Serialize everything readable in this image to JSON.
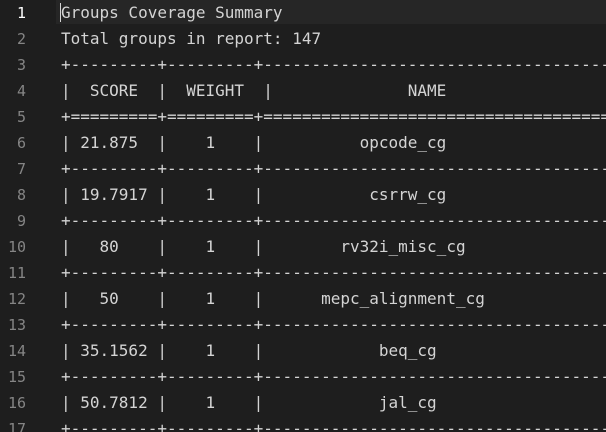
{
  "editor": {
    "lines": [
      {
        "number": "1",
        "text": "Groups Coverage Summary"
      },
      {
        "number": "2",
        "text": "Total groups in report: 147"
      },
      {
        "number": "3",
        "text": "+---------+---------+-------------------------------------------"
      },
      {
        "number": "4",
        "text": "|  SCORE  |  WEIGHT  |              NAME"
      },
      {
        "number": "5",
        "text": "+=========+=========+==========================================="
      },
      {
        "number": "6",
        "text": "| 21.875  |    1    |          opcode_cg"
      },
      {
        "number": "7",
        "text": "+---------+---------+-------------------------------------------"
      },
      {
        "number": "8",
        "text": "| 19.7917 |    1    |           csrrw_cg"
      },
      {
        "number": "9",
        "text": "+---------+---------+-------------------------------------------"
      },
      {
        "number": "10",
        "text": "|   80    |    1    |        rv32i_misc_cg"
      },
      {
        "number": "11",
        "text": "+---------+---------+-------------------------------------------"
      },
      {
        "number": "12",
        "text": "|   50    |    1    |      mepc_alignment_cg"
      },
      {
        "number": "13",
        "text": "+---------+---------+-------------------------------------------"
      },
      {
        "number": "14",
        "text": "| 35.1562 |    1    |            beq_cg"
      },
      {
        "number": "15",
        "text": "+---------+---------+-------------------------------------------"
      },
      {
        "number": "16",
        "text": "| 50.7812 |    1    |            jal_cg"
      },
      {
        "number": "17",
        "text": "+---------+---------+-------------------------------------------"
      }
    ]
  }
}
